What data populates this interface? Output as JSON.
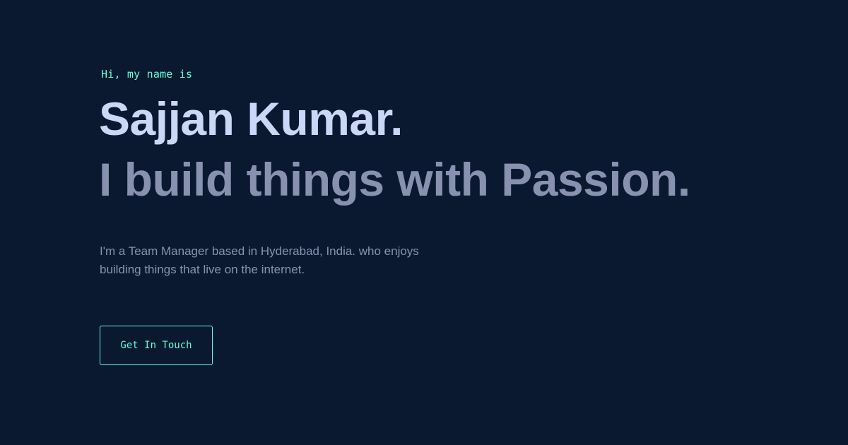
{
  "hero": {
    "intro": "Hi, my name is",
    "name": "Sajjan Kumar.",
    "tagline": "I build things with Passion.",
    "bio": "I'm a Team Manager based in Hyderabad, India. who enjoys building things that live on the internet.",
    "cta_label": "Get In Touch"
  },
  "colors": {
    "background": "#0a192f",
    "accent": "#64ffda",
    "heading": "#ccd6f6",
    "muted": "#8892b0"
  }
}
